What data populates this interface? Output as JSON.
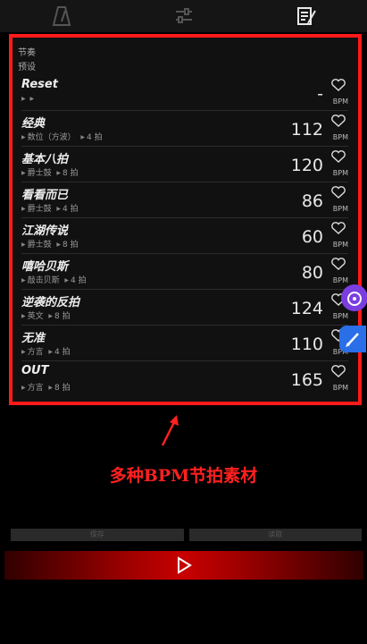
{
  "toolbar": {
    "tabs": [
      {
        "icon": "metronome-icon",
        "active": false
      },
      {
        "icon": "sliders-icon",
        "active": false
      },
      {
        "icon": "edit-note-icon",
        "active": true
      }
    ]
  },
  "list": {
    "header": "节奏",
    "subheader": "预设",
    "bpm_unit": "BPM",
    "items": [
      {
        "name": "Reset",
        "meta1": "",
        "meta2": "",
        "bpm": "-"
      },
      {
        "name": "经典",
        "meta1": "数位（方波）",
        "meta2": "4 拍",
        "bpm": "112"
      },
      {
        "name": "基本八拍",
        "meta1": "爵士鼓",
        "meta2": "8 拍",
        "bpm": "120"
      },
      {
        "name": "看看而已",
        "meta1": "爵士鼓",
        "meta2": "4 拍",
        "bpm": "86"
      },
      {
        "name": "江湖传说",
        "meta1": "爵士鼓",
        "meta2": "8 拍",
        "bpm": "60"
      },
      {
        "name": "嘻哈贝斯",
        "meta1": "敲击贝斯",
        "meta2": "4 拍",
        "bpm": "80"
      },
      {
        "name": "逆袭的反拍",
        "meta1": "英文",
        "meta2": "8 拍",
        "bpm": "124"
      },
      {
        "name": "无准",
        "meta1": "方言",
        "meta2": "4 拍",
        "bpm": "110"
      },
      {
        "name": "OUT",
        "meta1": "方言",
        "meta2": "8 拍",
        "bpm": "165"
      }
    ]
  },
  "annotation": {
    "text": "多种BPM节拍素材",
    "color": "#ff2020"
  },
  "buttons": {
    "save_label": "保存",
    "load_label": "读取"
  },
  "player": {
    "play_icon": "play-icon"
  }
}
